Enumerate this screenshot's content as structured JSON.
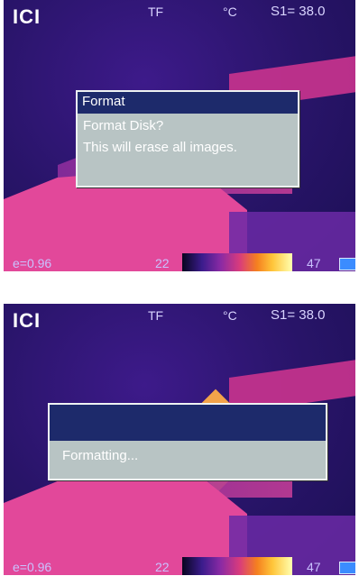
{
  "screens": [
    {
      "hud": {
        "logo": "ICI",
        "mode": "TF",
        "unit": "°C",
        "setpoint": "S1= 38.0",
        "emissivity": "e=0.96",
        "scale_min": "22",
        "scale_max": "47"
      },
      "dialog": {
        "title": "Format",
        "lines": [
          "Format Disk?",
          "This will erase all images."
        ]
      }
    },
    {
      "hud": {
        "logo": "ICI",
        "mode": "TF",
        "unit": "°C",
        "setpoint": "S1= 38.0",
        "emissivity": "e=0.96",
        "scale_min": "22",
        "scale_max": "47"
      },
      "dialog": {
        "title": "",
        "lines": [
          "Formatting..."
        ]
      }
    }
  ],
  "colors": {
    "dialog_title_bg": "#1d2a6b",
    "dialog_bg": "#b8c4c4",
    "battery": "#3b8cff"
  }
}
